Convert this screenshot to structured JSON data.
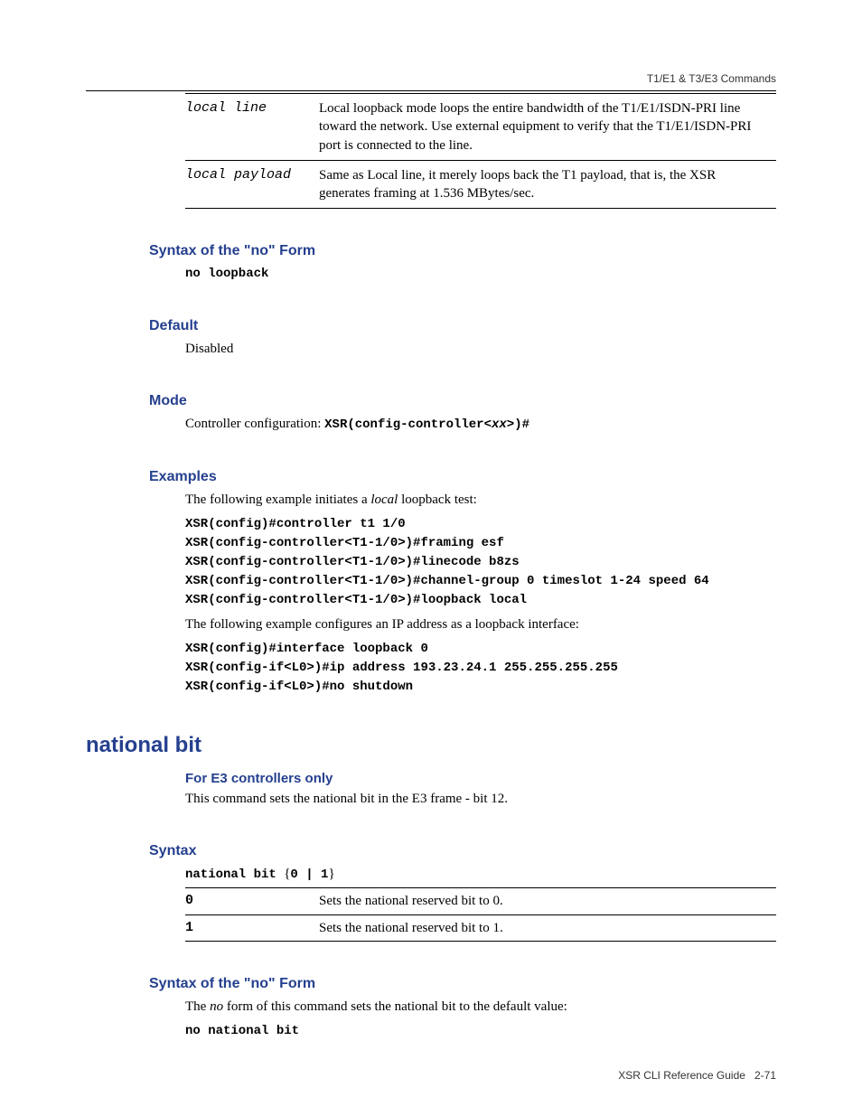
{
  "header": {
    "right_text": "T1/E1 & T3/E3 Commands"
  },
  "param_table": [
    {
      "key": "local line",
      "desc": "Local loopback mode loops the entire bandwidth of the T1/E1/ISDN-PRI line toward the network. Use external equipment to verify that the T1/E1/ISDN-PRI port is connected to the line."
    },
    {
      "key": "local payload",
      "desc": "Same as Local line, it merely loops back the T1 payload, that is, the XSR generates framing at 1.536 MBytes/sec."
    }
  ],
  "sections": {
    "syntax_no_form_1": {
      "heading": "Syntax of the \"no\" Form",
      "code": "no loopback"
    },
    "default": {
      "heading": "Default",
      "text": "Disabled"
    },
    "mode": {
      "heading": "Mode",
      "text_prefix": "Controller configuration: ",
      "code_prefix": "XSR(config-controller<",
      "code_var": "xx",
      "code_suffix": ">)#"
    },
    "examples": {
      "heading": "Examples",
      "intro_pre": "The following example initiates a ",
      "intro_italic": "local",
      "intro_post": " loopback test:",
      "code1": "XSR(config)#controller t1 1/0\nXSR(config-controller<T1-1/0>)#framing esf\nXSR(config-controller<T1-1/0>)#linecode b8zs\nXSR(config-controller<T1-1/0>)#channel-group 0 timeslot 1-24 speed 64\nXSR(config-controller<T1-1/0>)#loopback local",
      "intro2": "The following example configures an IP address as a loopback interface:",
      "code2": "XSR(config)#interface loopback 0\nXSR(config-if<L0>)#ip address 193.23.24.1 255.255.255.255\nXSR(config-if<L0>)#no shutdown"
    }
  },
  "command": {
    "heading": "national bit",
    "sub_heading": "For E3 controllers only",
    "desc": "This command sets the national bit in the E3 frame - bit 12."
  },
  "syntax": {
    "heading": "Syntax",
    "line_code": "national bit ",
    "line_brace_open": "{",
    "line_opt": "0 | 1",
    "line_brace_close": "}",
    "rows": [
      {
        "key": "0",
        "desc": "Sets the national reserved bit to 0."
      },
      {
        "key": "1",
        "desc": "Sets the national reserved bit to 1."
      }
    ]
  },
  "syntax_no_form_2": {
    "heading": "Syntax of the \"no\" Form",
    "text_pre": "The ",
    "text_italic": "no",
    "text_post": " form of this command sets the national bit to the default value:",
    "code": "no national bit"
  },
  "footer": {
    "guide": "XSR CLI Reference Guide",
    "page": "2-71"
  }
}
